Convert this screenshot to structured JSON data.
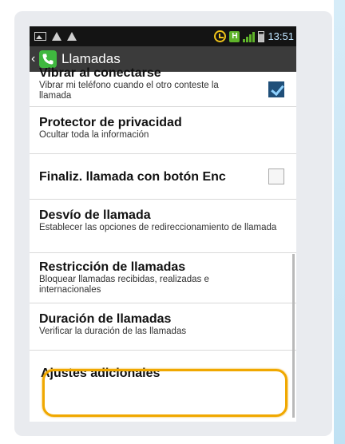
{
  "status_bar": {
    "time": "13:51",
    "icons": [
      "image-icon",
      "warning-icon",
      "warning-icon",
      "alarm-icon",
      "hspa-icon",
      "signal-icon",
      "battery-icon"
    ],
    "network_label": "H"
  },
  "header": {
    "back_icon": "chevron-left-icon",
    "app_icon": "phone-icon",
    "title": "Llamadas"
  },
  "settings": [
    {
      "title": "Vibrar al conectarse",
      "subtitle": "Vibrar mi teléfono cuando el otro conteste la llamada",
      "checkbox": true
    },
    {
      "title": "Protector de privacidad",
      "subtitle": "Ocultar toda la información"
    },
    {
      "title": "Finaliz. llamada con botón Enc",
      "subtitle": "",
      "checkbox": false
    },
    {
      "title": "Desvío de llamada",
      "subtitle": "Establecer las opciones de redireccionamiento de llamada"
    },
    {
      "title": "Restricción de llamadas",
      "subtitle": "Bloquear llamadas recibidas, realizadas e internacionales"
    },
    {
      "title": "Duración de llamadas",
      "subtitle": "Verificar la duración de las llamadas"
    },
    {
      "title": "Ajustes adicionales",
      "subtitle": "",
      "highlighted": true
    }
  ],
  "colors": {
    "highlight": "#f0a800",
    "checkbox_checked": "#1f4f79",
    "title_bar": "#3b3b3b",
    "status_bar": "#141414"
  }
}
